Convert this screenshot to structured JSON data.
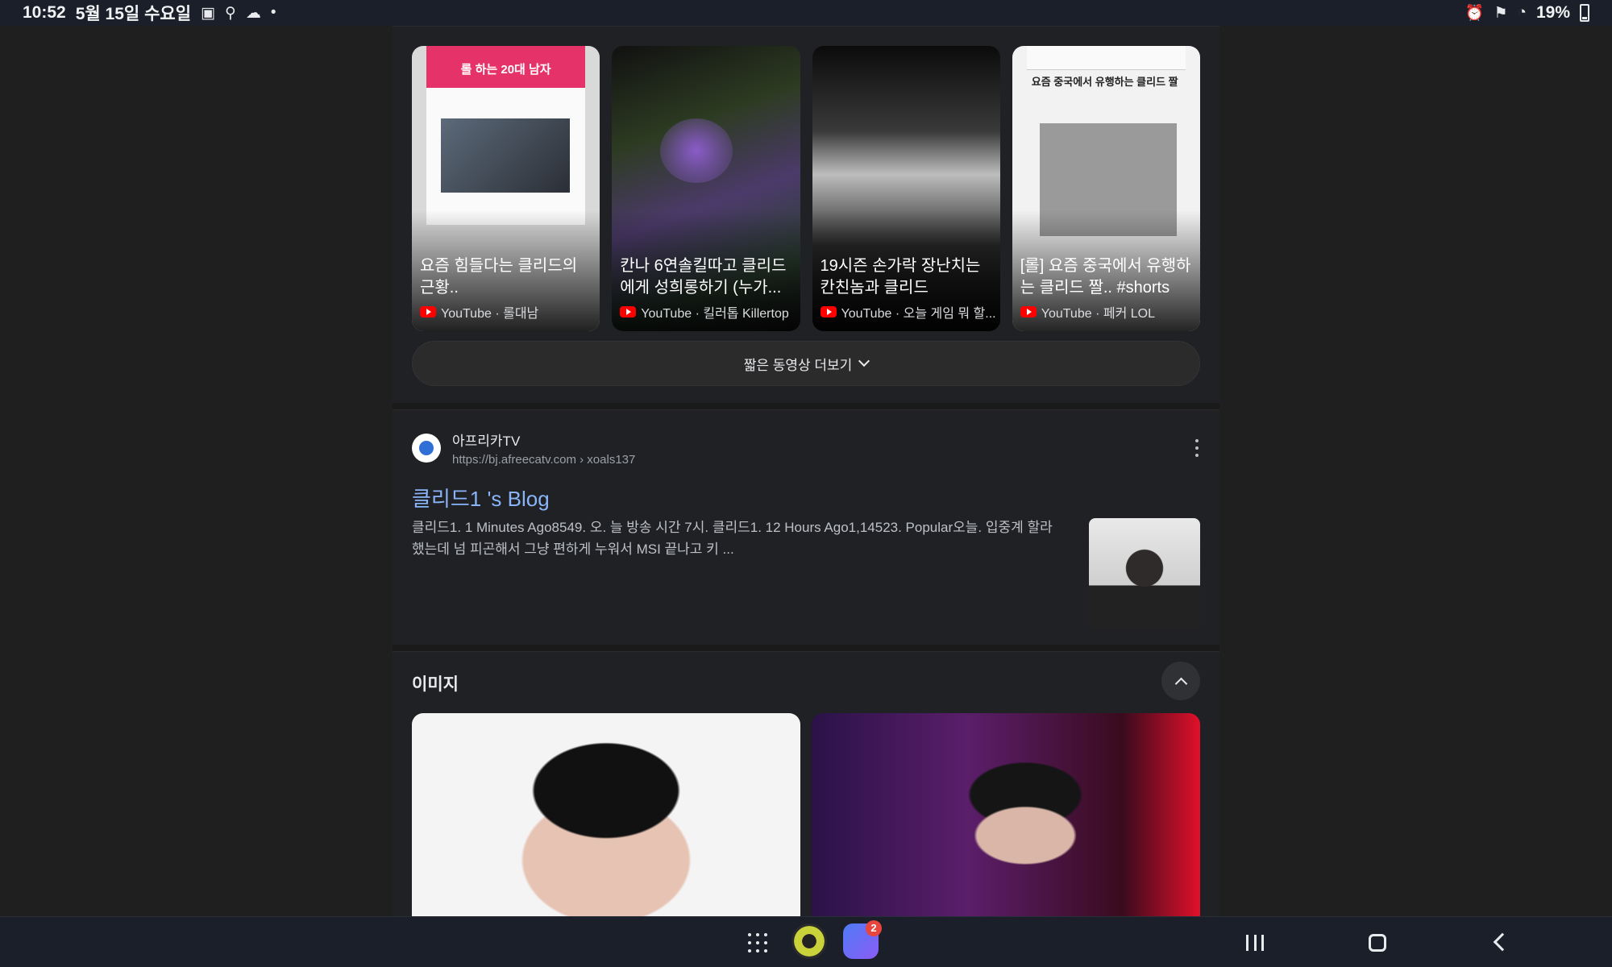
{
  "status_bar": {
    "time": "10:52",
    "date": "5월 15일 수요일",
    "battery": "19%"
  },
  "shorts": {
    "items": [
      {
        "title": "요즘 힘들다는 클리드의 근황..",
        "source": "YouTube · 롤대남",
        "thumb_text": "롤 하는 20대 남자"
      },
      {
        "title": "칸나 6연솔킬따고 클리드에게 성희롱하기 (누가...",
        "source": "YouTube · 킬러톱 Killertop",
        "thumb_text": ""
      },
      {
        "title": "19시즌 손가락 장난치는 칸친놈과 클리드",
        "source": "YouTube · 오늘 게임 뭐 할...",
        "thumb_text": ""
      },
      {
        "title": "[롤] 요즘 중국에서 유행하는 클리드 짤.. #shorts",
        "source": "YouTube · 페커 LOL",
        "thumb_text": "요즘 중국에서 유행하는 클리드 짤"
      }
    ],
    "more_label": "짧은 동영상 더보기"
  },
  "result": {
    "site_name": "아프리카TV",
    "url": "https://bj.afreecatv.com",
    "url_path": " › xoals137",
    "title": "클리드1 's Blog",
    "snippet": "클리드1. 1 Minutes Ago8549. 오. 늘 방송 시간 7시. 클리드1. 12 Hours Ago1,14523. Popular오늘. 입중계 할라했는데 넘 피곤해서 그냥 편하게 누워서 MSI 끝나고 키 ..."
  },
  "images": {
    "heading": "이미지"
  },
  "nav": {
    "badge_count": "2"
  },
  "colors": {
    "background": "#1f1f1f",
    "card": "#202124",
    "link": "#8ab4f8",
    "youtube_red": "#ff0000"
  }
}
